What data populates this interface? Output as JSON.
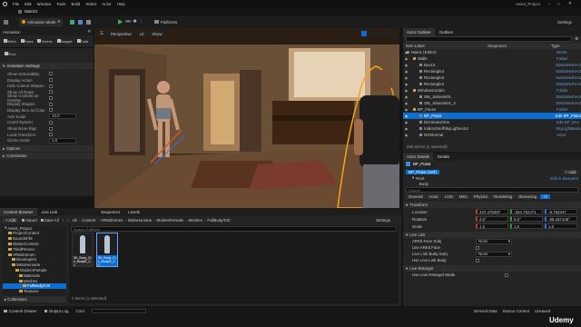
{
  "window": {
    "tab": "Main01",
    "project": "Asset_Project"
  },
  "menubar": {
    "items": [
      "File",
      "Edit",
      "Window",
      "Tools",
      "Build",
      "Select",
      "Actor",
      "Help"
    ]
  },
  "toolbar": {
    "mode": "Animation Mode",
    "platforms": "Platforms",
    "settings": "Settings"
  },
  "animation_panel": {
    "title": "Animation",
    "tools": [
      "Select",
      "Poses",
      "Tweens",
      "Snapper",
      "Trails",
      "Pivot"
    ],
    "section": "Animation Settings",
    "options": [
      {
        "label": "Show Selectability",
        "value": ""
      },
      {
        "label": "Display Action",
        "value": ""
      },
      {
        "label": "Hide Control Shapes",
        "value": ""
      },
      {
        "label": "Show All Rows",
        "value": ""
      },
      {
        "label": "Show Controls as Overlay",
        "value": ""
      },
      {
        "label": "Display Shapes",
        "value": ""
      },
      {
        "label": "Display Item as Color",
        "value": ""
      },
      {
        "label": "Axis Scale",
        "value": "10.0"
      },
      {
        "label": "Coord System",
        "value": ""
      },
      {
        "label": "Show Bone Rigs",
        "value": ""
      },
      {
        "label": "Local Transform",
        "value": ""
      },
      {
        "label": "Gizmo Scale",
        "value": "1.0"
      }
    ],
    "sections": [
      "Options",
      "Constraints"
    ]
  },
  "viewport": {
    "perspective": "Perspective",
    "lit": "Lit",
    "show": "Show"
  },
  "outliner": {
    "tabs": [
      "Actor Outliner",
      "Outliner"
    ],
    "columns": [
      "Item Label",
      "Type"
    ],
    "type_header": "Sequencer",
    "items": [
      {
        "label": "Main1 (Editor)",
        "type": "World",
        "indent": 0,
        "selected": false
      },
      {
        "label": "Walls",
        "type": "Folder",
        "indent": 1,
        "selected": false
      },
      {
        "label": "Box15",
        "type": "StaticMeshAct",
        "indent": 2,
        "selected": false
      },
      {
        "label": "Rectangle2",
        "type": "StaticMeshAct",
        "indent": 2,
        "selected": false
      },
      {
        "label": "Rectangle3",
        "type": "StaticMeshAct",
        "indent": 2,
        "selected": false
      },
      {
        "label": "Rectangle4",
        "type": "StaticMeshAct",
        "indent": 2,
        "selected": false
      },
      {
        "label": "WindowCurtain",
        "type": "Folder",
        "indent": 1,
        "selected": false
      },
      {
        "label": "SM_Jalousie01",
        "type": "StaticMeshAct",
        "indent": 2,
        "selected": false
      },
      {
        "label": "SM_Jalousie01_2",
        "type": "StaticMeshAct",
        "indent": 2,
        "selected": false
      },
      {
        "label": "BP_Faces",
        "type": "Folder",
        "indent": 1,
        "selected": false
      },
      {
        "label": "BP_Pialut",
        "type": "Edit BP_Pialut",
        "indent": 2,
        "selected": true
      },
      {
        "label": "DecimatorOne",
        "type": "Edit BP_Dec",
        "indent": 2,
        "selected": false
      },
      {
        "label": "IndirectSelfSkyLightActor",
        "type": "SkyLightBasic",
        "indent": 2,
        "selected": false
      },
      {
        "label": "NVStormal",
        "type": "Actor",
        "indent": 2,
        "selected": false
      }
    ],
    "footer": "265 actors (1 selected)"
  },
  "details": {
    "tabs": [
      "Actor Details",
      "Details"
    ],
    "actor": "BP_Pialut",
    "instance": "BP_Pialut (Self)",
    "root": "Root",
    "add_label": "+ Add",
    "blueprint_link": "Edit in Blueprint",
    "root_sub": "Body",
    "search_placeholder": "Search",
    "filters": [
      "General",
      "Actor",
      "LOD",
      "Misc",
      "Physics",
      "Rendering",
      "Streaming",
      "All"
    ],
    "transform_title": "Transform",
    "transform": [
      {
        "label": "Location",
        "x": "347.478387",
        "y": "-334.752471",
        "z": "-9.763347"
      },
      {
        "label": "Rotation",
        "x": "0.0°",
        "y": "0.0°",
        "z": "-96.187106°"
      },
      {
        "label": "Scale",
        "x": "1.0",
        "y": "1.0",
        "z": "1.0"
      }
    ],
    "livelink_title": "Live Link",
    "livelink": [
      {
        "label": "ARKit Face Subj",
        "value": "None"
      },
      {
        "label": "Use ARKit Face",
        "value": ""
      },
      {
        "label": "Live Link Body Subj",
        "value": "None"
      },
      {
        "label": "Use Live Link Body",
        "value": ""
      }
    ],
    "livelink_extra": "Use Live Link Body",
    "retarget_title": "Live Retarget",
    "retarget_item": "Use Live Retarget Mode"
  },
  "content_browser": {
    "tabs": [
      "Content Browser",
      "Live Link",
      "Sequencer",
      "Levels"
    ],
    "add": "+ Add",
    "import": "Import",
    "save_all": "Save All",
    "breadcrumb": [
      "All",
      "Content",
      "VRMZmmen",
      "MetaHumans",
      "ModernFemale",
      "Meshes",
      "FullBody/Ctrl"
    ],
    "settings": "Settings",
    "search_placeholder": "Search FullBody",
    "tree_root": "Asset_Project",
    "tree": [
      {
        "label": "ProjectContent",
        "indent": 1
      },
      {
        "label": "SoundsFile",
        "indent": 1
      },
      {
        "label": "StarterContent",
        "indent": 1
      },
      {
        "label": "ThirdPerson",
        "indent": 1
      },
      {
        "label": "VRMZmmen",
        "indent": 1
      },
      {
        "label": "Developers",
        "indent": 2
      },
      {
        "label": "MetaHumans",
        "indent": 2
      },
      {
        "label": "ModernFemale",
        "indent": 3
      },
      {
        "label": "Materials",
        "indent": 4
      },
      {
        "label": "Meshes",
        "indent": 4
      },
      {
        "label": "FullBody/Ctrl",
        "indent": 5
      },
      {
        "label": "Textures",
        "indent": 4
      }
    ],
    "collections": "Collections",
    "assets": [
      {
        "name": "SK_Body_Ctrl_BodyIK_01",
        "selected": false
      },
      {
        "name": "SK_Body_Ctrl_BodyIK_02",
        "selected": true
      }
    ],
    "status": "2 items (1 selected)"
  },
  "statusbar": {
    "items": [
      "Content Drawer",
      "Output Log",
      "Cmd"
    ],
    "right": [
      "Derived Data",
      "Source Control",
      "Unsaved"
    ]
  },
  "watermark": "Udemy"
}
